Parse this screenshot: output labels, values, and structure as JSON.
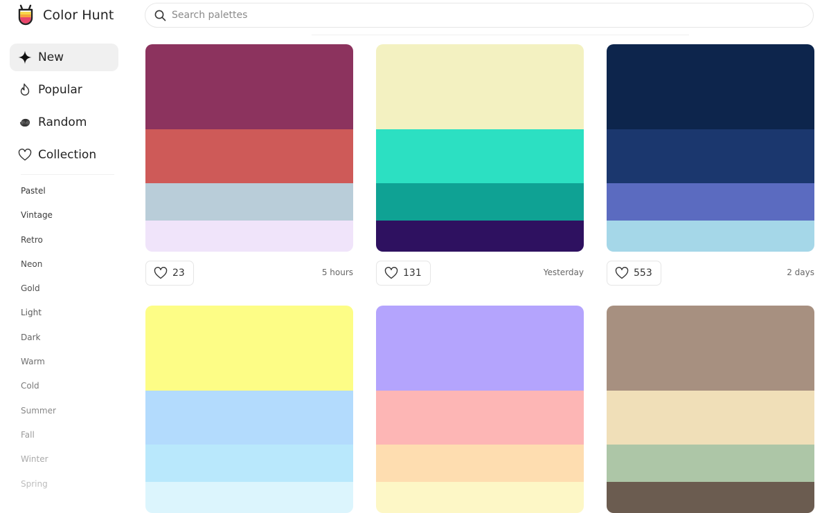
{
  "app": {
    "name": "Color Hunt"
  },
  "search": {
    "placeholder": "Search palettes"
  },
  "nav": [
    {
      "label": "New",
      "icon": "sparkle-icon",
      "active": true
    },
    {
      "label": "Popular",
      "icon": "flame-icon",
      "active": false
    },
    {
      "label": "Random",
      "icon": "spiral-icon",
      "active": false
    },
    {
      "label": "Collection",
      "icon": "heart-icon",
      "active": false
    }
  ],
  "tags": [
    {
      "label": "Pastel",
      "color": "#333333"
    },
    {
      "label": "Vintage",
      "color": "#3a3a3a"
    },
    {
      "label": "Retro",
      "color": "#444444"
    },
    {
      "label": "Neon",
      "color": "#4a4a4a"
    },
    {
      "label": "Gold",
      "color": "#505050"
    },
    {
      "label": "Light",
      "color": "#5a5a5a"
    },
    {
      "label": "Dark",
      "color": "#646464"
    },
    {
      "label": "Warm",
      "color": "#6e6e6e"
    },
    {
      "label": "Cold",
      "color": "#7a7a7a"
    },
    {
      "label": "Summer",
      "color": "#888888"
    },
    {
      "label": "Fall",
      "color": "#9a9a9a"
    },
    {
      "label": "Winter",
      "color": "#aaaaaa"
    },
    {
      "label": "Spring",
      "color": "#bdbdbd"
    }
  ],
  "palettes": [
    {
      "colors": [
        "#8C335E",
        "#CE5A58",
        "#B9CDD9",
        "#F0E4FA"
      ],
      "likes": "23",
      "time": "5 hours"
    },
    {
      "colors": [
        "#F3F1C1",
        "#2CE0C2",
        "#0FA294",
        "#2E1160"
      ],
      "likes": "131",
      "time": "Yesterday"
    },
    {
      "colors": [
        "#0D254C",
        "#1B376E",
        "#5B6BC0",
        "#A5D7E8"
      ],
      "likes": "553",
      "time": "2 days"
    },
    {
      "colors": [
        "#FDFD86",
        "#B3DBFD",
        "#B9E8FC",
        "#DCF5FD"
      ],
      "likes": "",
      "time": ""
    },
    {
      "colors": [
        "#B4A4FD",
        "#FDB6B5",
        "#FEDDB0",
        "#FDF7C6"
      ],
      "likes": "",
      "time": ""
    },
    {
      "colors": [
        "#A79080",
        "#F0DFB8",
        "#ADC6A7",
        "#6B5C50"
      ],
      "likes": "",
      "time": ""
    }
  ]
}
